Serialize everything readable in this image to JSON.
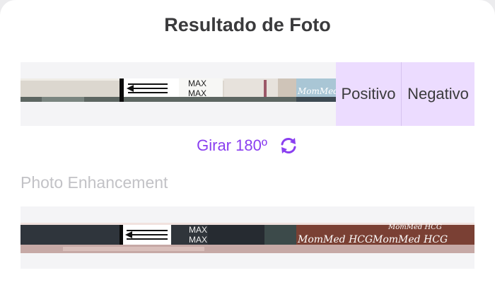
{
  "header": {
    "title": "Resultado de Foto"
  },
  "result": {
    "positive_label": "Positivo",
    "negative_label": "Negativo",
    "strip_max_text": "MAX",
    "strip_brand_text": "MomMed H"
  },
  "rotate": {
    "label": "Girar 180º",
    "icon": "rotate-icon"
  },
  "enhancement": {
    "title": "Photo Enhancement",
    "strip_max_text": "MAX",
    "strip_brand_text": "MomMed HCG"
  },
  "colors": {
    "accent": "#8a3ff0",
    "label_bg": "#ecdcff",
    "panel_bg": "#f4f4f6",
    "enhanced_strip": "#7a4034"
  }
}
